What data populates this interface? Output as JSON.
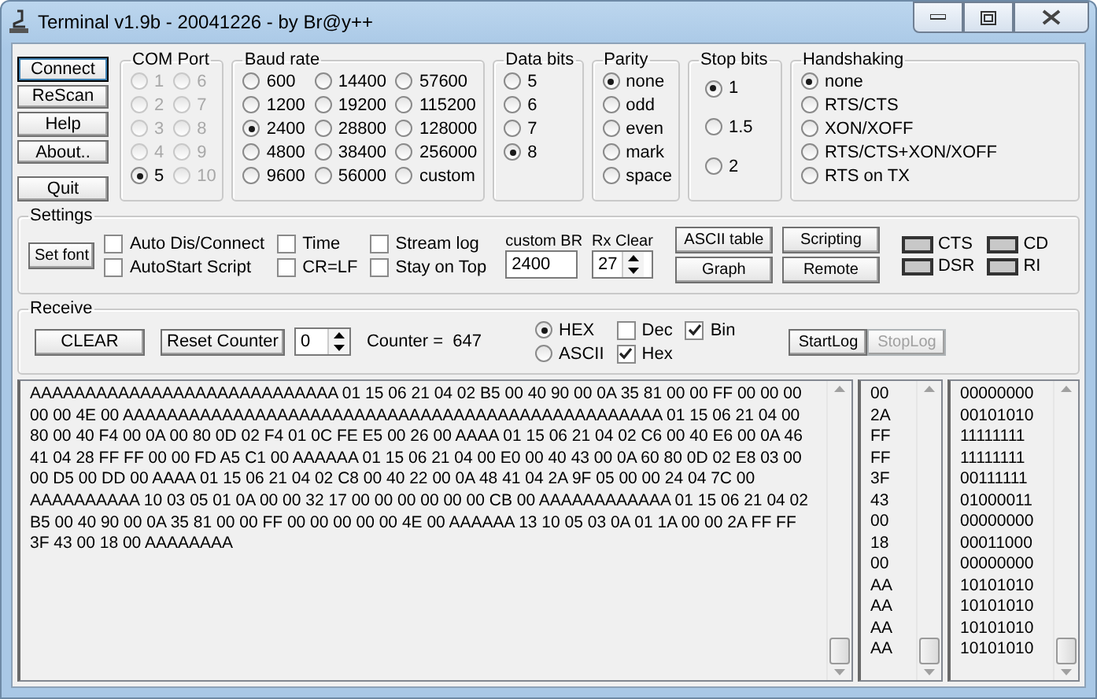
{
  "window": {
    "title": "Terminal v1.9b - 20041226 - by Br@y++"
  },
  "main_buttons": [
    {
      "label": "Connect",
      "default": true
    },
    {
      "label": "ReScan",
      "default": false
    },
    {
      "label": "Help",
      "default": false
    },
    {
      "label": "About..",
      "default": false
    },
    {
      "label": "Quit",
      "default": false
    }
  ],
  "com_port": {
    "title": "COM Port",
    "options": [
      {
        "label": "1",
        "selected": false,
        "disabled": true
      },
      {
        "label": "6",
        "selected": false,
        "disabled": true
      },
      {
        "label": "2",
        "selected": false,
        "disabled": true
      },
      {
        "label": "7",
        "selected": false,
        "disabled": true
      },
      {
        "label": "3",
        "selected": false,
        "disabled": true
      },
      {
        "label": "8",
        "selected": false,
        "disabled": true
      },
      {
        "label": "4",
        "selected": false,
        "disabled": true
      },
      {
        "label": "9",
        "selected": false,
        "disabled": true
      },
      {
        "label": "5",
        "selected": true,
        "disabled": false
      },
      {
        "label": "10",
        "selected": false,
        "disabled": true
      }
    ]
  },
  "baud_rate": {
    "title": "Baud rate",
    "options": [
      {
        "label": "600",
        "selected": false
      },
      {
        "label": "14400",
        "selected": false
      },
      {
        "label": "57600",
        "selected": false
      },
      {
        "label": "1200",
        "selected": false
      },
      {
        "label": "19200",
        "selected": false
      },
      {
        "label": "115200",
        "selected": false
      },
      {
        "label": "2400",
        "selected": true
      },
      {
        "label": "28800",
        "selected": false
      },
      {
        "label": "128000",
        "selected": false
      },
      {
        "label": "4800",
        "selected": false
      },
      {
        "label": "38400",
        "selected": false
      },
      {
        "label": "256000",
        "selected": false
      },
      {
        "label": "9600",
        "selected": false
      },
      {
        "label": "56000",
        "selected": false
      },
      {
        "label": "custom",
        "selected": false
      }
    ]
  },
  "data_bits": {
    "title": "Data bits",
    "options": [
      {
        "label": "5",
        "selected": false
      },
      {
        "label": "6",
        "selected": false
      },
      {
        "label": "7",
        "selected": false
      },
      {
        "label": "8",
        "selected": true
      }
    ]
  },
  "parity": {
    "title": "Parity",
    "options": [
      {
        "label": "none",
        "selected": true
      },
      {
        "label": "odd",
        "selected": false
      },
      {
        "label": "even",
        "selected": false
      },
      {
        "label": "mark",
        "selected": false
      },
      {
        "label": "space",
        "selected": false
      }
    ]
  },
  "stop_bits": {
    "title": "Stop bits",
    "options": [
      {
        "label": "1",
        "selected": true
      },
      {
        "label": "1.5",
        "selected": false
      },
      {
        "label": "2",
        "selected": false
      }
    ]
  },
  "handshaking": {
    "title": "Handshaking",
    "options": [
      {
        "label": "none",
        "selected": true
      },
      {
        "label": "RTS/CTS",
        "selected": false
      },
      {
        "label": "XON/XOFF",
        "selected": false
      },
      {
        "label": "RTS/CTS+XON/XOFF",
        "selected": false
      },
      {
        "label": "RTS on TX",
        "selected": false
      }
    ]
  },
  "settings": {
    "title": "Settings",
    "set_font": "Set font",
    "checkboxes": [
      {
        "label": "Auto Dis/Connect",
        "checked": false
      },
      {
        "label": "AutoStart Script",
        "checked": false
      },
      {
        "label": "Time",
        "checked": false
      },
      {
        "label": "CR=LF",
        "checked": false
      },
      {
        "label": "Stream log",
        "checked": false
      },
      {
        "label": "Stay on Top",
        "checked": false
      }
    ],
    "custom_br": {
      "label": "custom BR",
      "value": "2400"
    },
    "rx_clear": {
      "label": "Rx Clear",
      "value": "27"
    },
    "buttons": [
      "ASCII table",
      "Scripting",
      "Graph",
      "Remote"
    ],
    "signals": [
      {
        "label": "CTS",
        "on": false
      },
      {
        "label": "CD",
        "on": false
      },
      {
        "label": "DSR",
        "on": false
      },
      {
        "label": "RI",
        "on": false
      }
    ]
  },
  "receive": {
    "title": "Receive",
    "clear": "CLEAR",
    "reset_counter": "Reset Counter",
    "counter_spin": "0",
    "counter": "Counter =  647",
    "modes": [
      {
        "label": "HEX",
        "selected": true
      },
      {
        "label": "ASCII",
        "selected": false
      }
    ],
    "checkboxes": [
      {
        "label": "Dec",
        "checked": false
      },
      {
        "label": "Bin",
        "checked": true
      },
      {
        "label": "Hex",
        "checked": true
      }
    ],
    "log_buttons": [
      {
        "label": "StartLog",
        "disabled": false
      },
      {
        "label": "StopLog",
        "disabled": true
      }
    ]
  },
  "output": "AAAAAAAAAAAAAAAAAAAAAAAAAAAA 01 15 06 21 04 02 B5 00 40 90 00 0A 35 81 00 00 FF 00 00 00 00 00 4E 00 AAAAAAAAAAAAAAAAAAAAAAAAAAAAAAAAAAAAAAAAAAAAAAAAA 01 15 06 21 04 00 80 00 40 F4 00 0A 00 80 0D 02 F4 01 0C FE E5 00 26 00 AAAA 01 15 06 21 04 02 C6 00 40 E6 00 0A 46 41 04 28 FF FF 00 00 FD A5 C1 00 AAAAAA 01 15 06 21 04 00 E0 00 40 43 00 0A 60 80 0D 02 E8 03 00 00 D5 00 DD 00 AAAA 01 15 06 21 04 02 C8 00 40 22 00 0A 48 41 04 2A 9F 05 00 00 24 04 7C 00 AAAAAAAAAA 10 03 05 01 0A 00 00 32 17 00 00 00 00 00 00 CB 00 AAAAAAAAAAAA 01 15 06 21 04 02 B5 00 40 90 00 0A 35 81 00 00 FF 00 00 00 00 00 4E 00 AAAAAA 13 10 05 03 0A 01 1A 00 00 2A FF FF 3F 43 00 18 00 AAAAAAAA",
  "hex_column": [
    "00",
    "2A",
    "FF",
    "FF",
    "3F",
    "43",
    "00",
    "18",
    "00",
    "AA",
    "AA",
    "AA",
    "AA"
  ],
  "bin_column": [
    "00000000",
    "00101010",
    "11111111",
    "11111111",
    "00111111",
    "01000011",
    "00000000",
    "00011000",
    "00000000",
    "10101010",
    "10101010",
    "10101010",
    "10101010"
  ]
}
